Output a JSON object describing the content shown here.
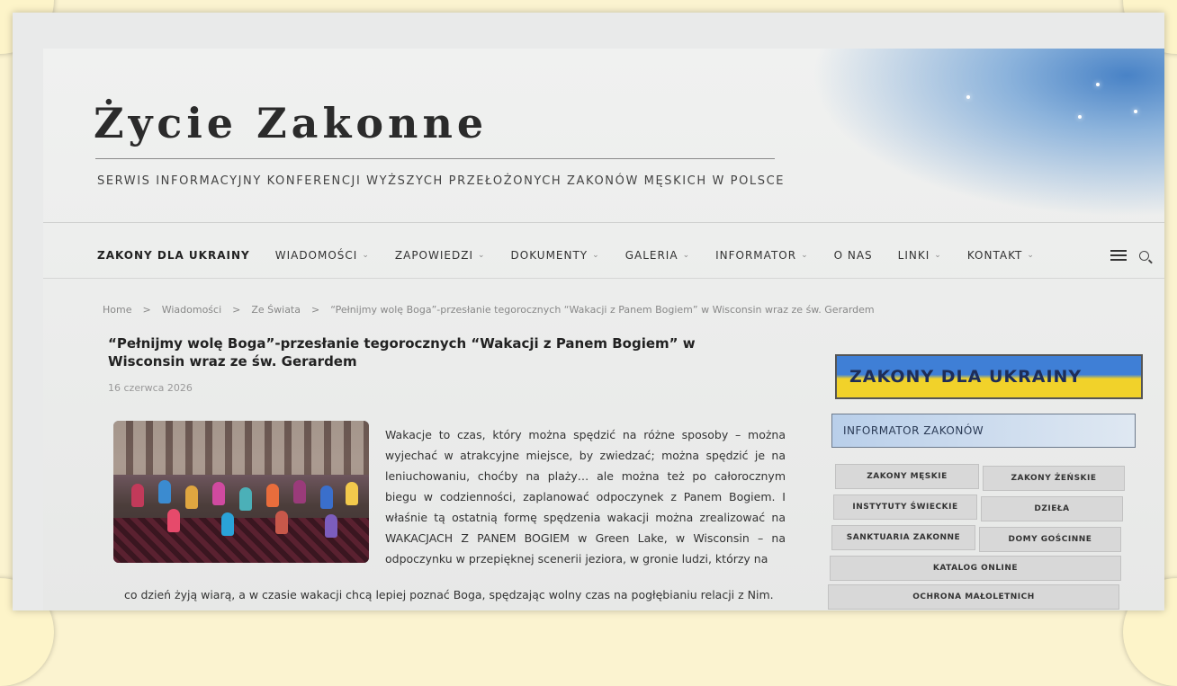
{
  "site": {
    "title": "Życie Zakonne",
    "tagline": "SERWIS INFORMACYJNY KONFERENCJI WYŻSZYCH PRZEŁOŻONYCH ZAKONÓW MĘSKICH W POLSCE"
  },
  "nav": {
    "items": [
      {
        "label": "ZAKONY DLA UKRAINY",
        "dropdown": false
      },
      {
        "label": "WIADOMOŚCI",
        "dropdown": true
      },
      {
        "label": "ZAPOWIEDZI",
        "dropdown": true
      },
      {
        "label": "DOKUMENTY",
        "dropdown": true
      },
      {
        "label": "GALERIA",
        "dropdown": true
      },
      {
        "label": "INFORMATOR",
        "dropdown": true
      },
      {
        "label": "O NAS",
        "dropdown": false
      },
      {
        "label": "LINKI",
        "dropdown": true
      },
      {
        "label": "KONTAKT",
        "dropdown": true
      }
    ],
    "menu_icon": "hamburger-icon",
    "search_icon": "search-icon"
  },
  "breadcrumb": {
    "items": [
      "Home",
      "Wiadomości",
      "Ze Świata",
      "“Pełnijmy wolę Boga”-przesłanie tegorocznych “Wakacji z Panem Bogiem” w Wisconsin wraz ze św. Gerardem"
    ],
    "separator": ">"
  },
  "post": {
    "title": "“Pełnijmy wolę Boga”-przesłanie tegorocznych “Wakacji z Panem Bogiem” w Wisconsin wraz ze św. Gerardem",
    "date": "16 czerwca 2026",
    "body": "Wakacje to czas, który można spędzić na różne sposoby – można wyjechać w atrakcyjne miejsce, by zwiedzać; można spędzić je na leniuchowaniu, choćby na plaży… ale można też po całorocznym biegu w codzienności, zaplanować odpoczynek z Panem Bogiem. I właśnie tą ostatnią formę spędzenia wakacji można zrealizować na WAKACJACH Z PANEM BOGIEM w Green Lake, w Wisconsin – na odpoczynku w przepięknej scenerii jeziora, w gronie ludzi, którzy na",
    "body_last": "co dzień żyją wiarą, a w czasie wakacji chcą lepiej poznać Boga, spędzając wolny czas na pogłębianiu relacji z Nim."
  },
  "sidebar": {
    "ukraine_banner": "ZAKONY DLA UKRAINY",
    "informator": "INFORMATOR ZAKONÓW",
    "buttons": [
      "ZAKONY MĘSKIE",
      "ZAKONY ŻEŃSKIE",
      "INSTYTUTY ŚWIECKIE",
      "DZIEŁA",
      "SANKTUARIA ZAKONNE",
      "DOMY GOŚCINNE",
      "KATALOG ONLINE",
      "OCHRONA MAŁOLETNICH"
    ]
  },
  "colors": {
    "ukraine_blue": "#3f7fd6",
    "ukraine_yellow": "#f1d22a",
    "frame": "#fbf3d0"
  }
}
